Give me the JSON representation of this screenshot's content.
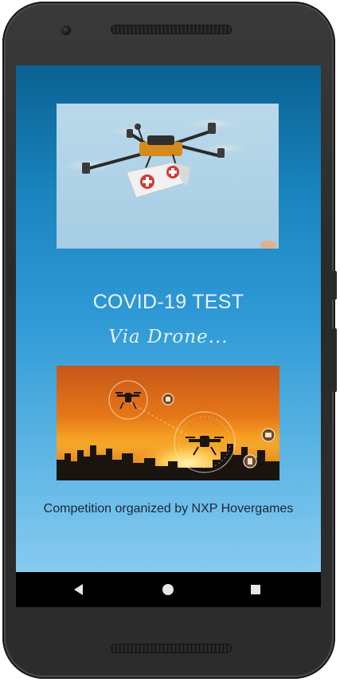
{
  "screen": {
    "title": "COVID-19 TEST",
    "subtitle": "Via Drone...",
    "footer": "Competition organized by NXP Hovergames"
  },
  "images": {
    "top": "drone-with-medical-box",
    "bottom": "drones-over-city-at-sunset"
  },
  "navbar": {
    "back": "back-icon",
    "home": "home-icon",
    "recents": "recents-icon"
  },
  "colors": {
    "screen_top": "#0a6193",
    "screen_bottom": "#87cbf0",
    "title_text": "#e8f3fb",
    "footer_text": "#1b2733",
    "navbar": "#000000"
  }
}
